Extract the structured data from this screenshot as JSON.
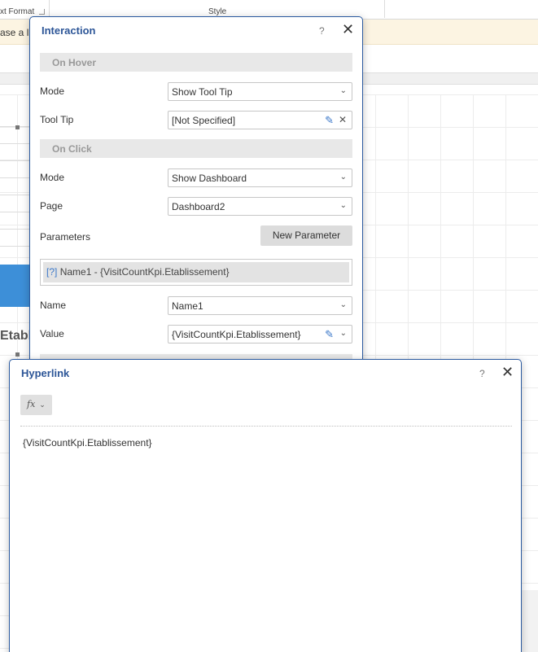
{
  "background": {
    "ribbon": {
      "text_format_label": "xt Format",
      "style_label": "Style"
    },
    "notice_text": "ase a lic",
    "side_text": "Etabli"
  },
  "interaction": {
    "title": "Interaction",
    "help": "?",
    "close": "✕",
    "on_hover": {
      "header": "On Hover",
      "mode_label": "Mode",
      "mode_value": "Show Tool Tip",
      "tooltip_label": "Tool Tip",
      "tooltip_value": "[Not Specified]"
    },
    "on_click": {
      "header": "On Click",
      "mode_label": "Mode",
      "mode_value": "Show Dashboard",
      "page_label": "Page",
      "page_value": "Dashboard2",
      "parameters_label": "Parameters",
      "new_parameter_button": "New Parameter",
      "parameter_item": {
        "marker": "[?]",
        "text": "Name1 - {VisitCountKpi.Etablissement}"
      },
      "name_label": "Name",
      "name_value": "Name1",
      "value_label": "Value",
      "value_value": "{VisitCountKpi.Etablissement}"
    }
  },
  "hyperlink": {
    "title": "Hyperlink",
    "help": "?",
    "close": "✕",
    "fx_button": "fx",
    "expression": "{VisitCountKpi.Etablissement}"
  },
  "icons": {
    "caret": "⌄",
    "pencil": "✎",
    "clear": "✕"
  },
  "colors": {
    "dialog_title": "#2c5597",
    "dialog_border": "#2b5aa0",
    "section_bg": "#e8e8e8",
    "notice_bg": "#fcf4e2",
    "accent_blue": "#3d8fd8"
  }
}
